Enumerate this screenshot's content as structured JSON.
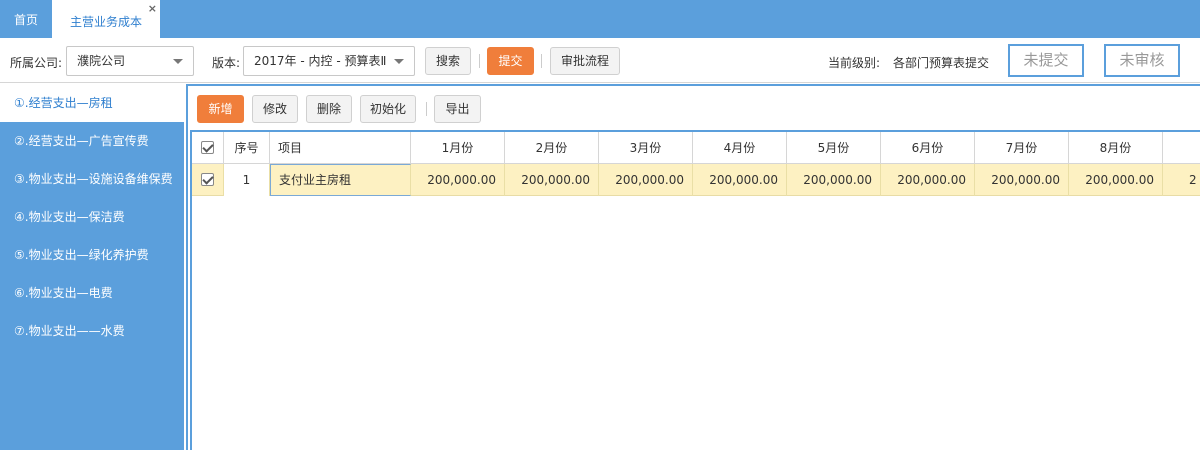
{
  "tabs": [
    {
      "label": "首页"
    },
    {
      "label": "主营业务成本"
    }
  ],
  "tab_close": "×",
  "toolbar": {
    "company_label": "所属公司:",
    "company_value": "濮院公司",
    "version_label": "版本:",
    "version_value": "2017年 - 内控 - 预算表Ⅱ",
    "search_label": "搜索",
    "submit_label": "提交",
    "approval_label": "审批流程",
    "level_label": "当前级别:",
    "level_value": "各部门预算表提交",
    "status_unsubmitted": "未提交",
    "status_unreviewed": "未审核"
  },
  "sidebar": {
    "items": [
      {
        "label": "①.经营支出—房租"
      },
      {
        "label": "②.经营支出—广告宣传费"
      },
      {
        "label": "③.物业支出—设施设备维保费"
      },
      {
        "label": "④.物业支出—保洁费"
      },
      {
        "label": "⑤.物业支出—绿化养护费"
      },
      {
        "label": "⑥.物业支出—电费"
      },
      {
        "label": "⑦.物业支出——水费"
      }
    ]
  },
  "actions": {
    "add": "新增",
    "edit": "修改",
    "delete": "删除",
    "init": "初始化",
    "export": "导出"
  },
  "grid": {
    "headers": {
      "seq": "序号",
      "item": "项目",
      "m1": "1月份",
      "m2": "2月份",
      "m3": "3月份",
      "m4": "4月份",
      "m5": "5月份",
      "m6": "6月份",
      "m7": "7月份",
      "m8": "8月份"
    },
    "rows": [
      {
        "seq": "1",
        "item": "支付业主房租",
        "m1": "200,000.00",
        "m2": "200,000.00",
        "m3": "200,000.00",
        "m4": "200,000.00",
        "m5": "200,000.00",
        "m6": "200,000.00",
        "m7": "200,000.00",
        "m8": "200,000.00",
        "m9": "2"
      }
    ]
  },
  "colors": {
    "primary": "#5b9fdc",
    "accent": "#f07e3b",
    "row_highlight": "#fdf1c2"
  }
}
